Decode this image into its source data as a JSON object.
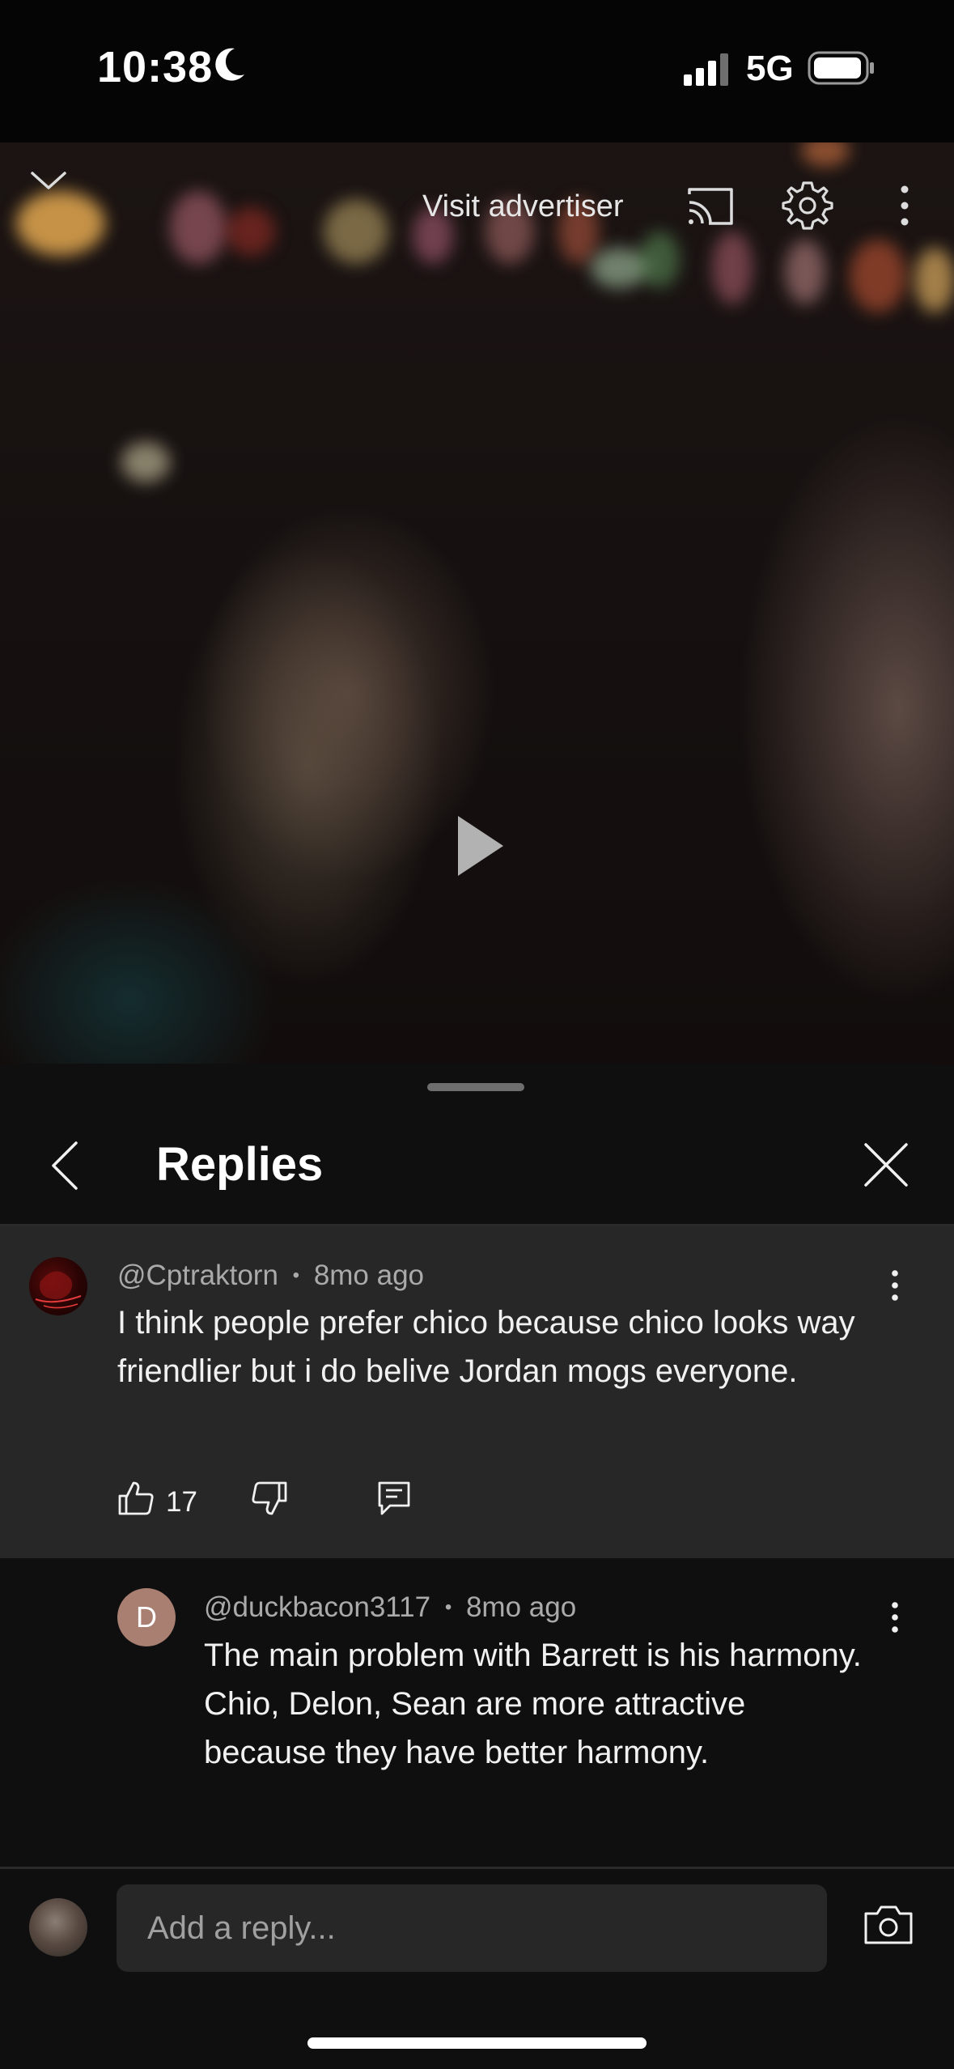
{
  "status_bar": {
    "time": "10:38",
    "network": "5G",
    "icons": [
      "moon-icon",
      "signal-icon",
      "battery-icon"
    ]
  },
  "video": {
    "visit_advertiser": "Visit advertiser",
    "icons": [
      "chevron-down-icon",
      "cast-icon",
      "gear-icon",
      "more-vertical-icon",
      "play-icon"
    ]
  },
  "replies_panel": {
    "title": "Replies",
    "icons": [
      "back-arrow-icon",
      "close-icon"
    ]
  },
  "parent_comment": {
    "author": "@Cptraktorn",
    "separator": "•",
    "time": "8mo ago",
    "text": "I think people prefer chico because chico looks way friendlier but i do belive Jordan mogs everyone.",
    "likes": "17"
  },
  "reply": {
    "avatar_letter": "D",
    "author": "@duckbacon3117",
    "separator": "•",
    "time": "8mo ago",
    "text": "The main problem with Barrett is his harmony. Chio, Delon, Sean are more attractive because they have better harmony."
  },
  "composer": {
    "placeholder": "Add a reply..."
  },
  "colors": {
    "background": "#0f0f0f",
    "highlighted_comment": "#272727",
    "reply_avatar": "#a97f72",
    "secondary_text": "#aaaaaa"
  }
}
